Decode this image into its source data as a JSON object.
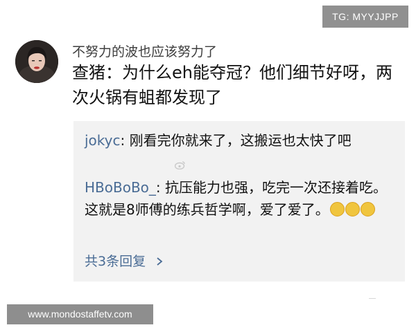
{
  "tag": "TG: MYYJJPP",
  "comment": {
    "username": "不努力的波也应该努力了",
    "text": "查猪：为什么eh能夺冠？他们细节好呀，两次火锅有蛆都发现了"
  },
  "replies": [
    {
      "user": "jokyc",
      "text": ": 刚看完你就来了，这搬运也太快了吧"
    },
    {
      "user": "HBoBoBo_",
      "text": ": 抗压能力也强，吃完一次还接着吃。 这就是8师傅的练兵哲学啊，爱了爱了。",
      "emoji": "grin-emoji"
    }
  ],
  "more_replies": "共3条回复",
  "watermark_url": "www.mondostaffetv.com",
  "colors": {
    "reply_user": "#4a6c95",
    "reply_bg": "#f2f2f2",
    "watermark_bg": "#909090"
  }
}
